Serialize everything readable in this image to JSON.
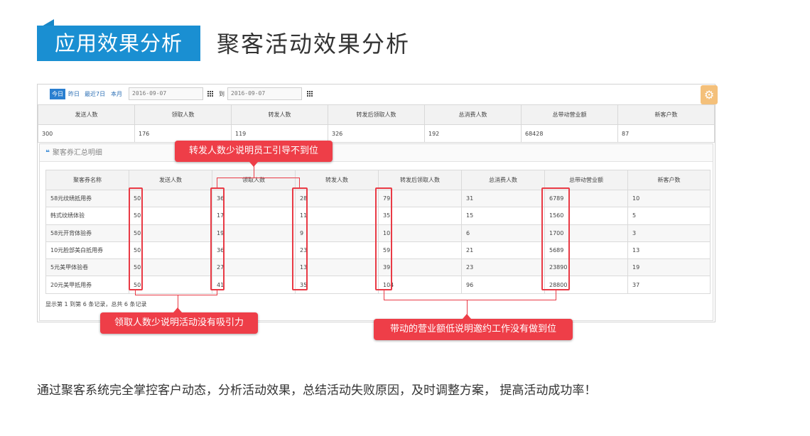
{
  "header": {
    "badge": "应用效果分析",
    "title": "聚客活动效果分析"
  },
  "toolbar": {
    "quick_ranges": [
      "今日",
      "昨日",
      "最近7日",
      "本月"
    ],
    "active_range": "今日",
    "start_date": "2016-09-07",
    "to_label": "到",
    "end_date": "2016-09-07",
    "settings_icon": "gear-icon"
  },
  "summary": {
    "columns": [
      "发送人数",
      "领取人数",
      "转发人数",
      "转发后领取人数",
      "总消费人数",
      "总带动营业额",
      "新客户数"
    ],
    "values": [
      "300",
      "176",
      "119",
      "326",
      "192",
      "68428",
      "87"
    ]
  },
  "detail": {
    "panel_icon": "quote-icon",
    "panel_title": "聚客券汇总明细",
    "columns": [
      "聚客券名称",
      "发送人数",
      "领取人数",
      "转发人数",
      "转发后领取人数",
      "总消费人数",
      "总带动营业额",
      "新客户数"
    ],
    "rows": [
      [
        "58元纹绣抵用券",
        "50",
        "36",
        "",
        "28",
        "79",
        "31",
        "6789",
        "10"
      ],
      [
        "韩式纹绣体验",
        "50",
        "17",
        "",
        "11",
        "35",
        "15",
        "1560",
        "5"
      ],
      [
        "58元开背体验券",
        "50",
        "19",
        "",
        "9",
        "10",
        "6",
        "1700",
        "3"
      ],
      [
        "10元脸部美白抵用券",
        "50",
        "36",
        "",
        "23",
        "59",
        "21",
        "5689",
        "13"
      ],
      [
        "5元美甲体验卷",
        "50",
        "27",
        "",
        "13",
        "39",
        "23",
        "23890",
        "19"
      ],
      [
        "20元美甲抵用券",
        "50",
        "41",
        "",
        "35",
        "104",
        "96",
        "28800",
        "37"
      ]
    ],
    "pager": "显示第 1 到第 6 条记录，总共 6 条记录"
  },
  "annotations": {
    "forward_callout": "转发人数少说明员工引导不到位",
    "claim_callout": "领取人数少说明活动没有吸引力",
    "revenue_callout": "带动的营业额低说明邀约工作没有做到位",
    "highlight_color": "#e93a45"
  },
  "footer": {
    "text": "通过聚客系统完全掌控客户动态，分析活动效果，总结活动失败原因，及时调整方案， 提高活动成功率！"
  },
  "colors": {
    "brand_blue": "#1a8fd2",
    "callout_red": "#ee3e48",
    "settings_orange": "#f4c07a"
  }
}
